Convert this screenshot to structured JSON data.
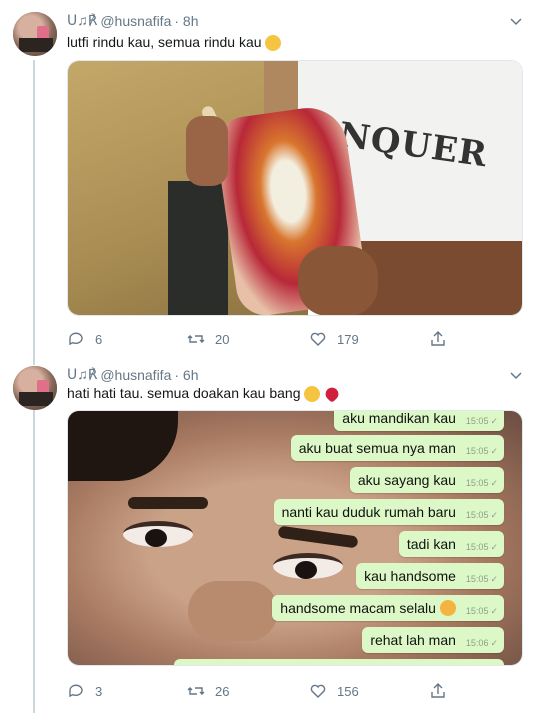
{
  "tweets": [
    {
      "handle": "@husnafifa",
      "name_glyphs": "ᑌ♫℟",
      "time": "· 8h",
      "text": "lutfi rindu kau, semua rindu kau",
      "replies": "6",
      "retweets": "20",
      "likes": "179"
    },
    {
      "handle": "@husnafifa",
      "name_glyphs": "ᑌ♫℟",
      "time": "· 6h",
      "text": "hati hati tau. semua doakan kau bang",
      "replies": "3",
      "retweets": "26",
      "likes": "156",
      "chat": [
        {
          "text": "aku mandikan kau",
          "time": "15:05"
        },
        {
          "text": "aku buat semua nya man",
          "time": "15:05"
        },
        {
          "text": "aku sayang kau",
          "time": "15:05"
        },
        {
          "text": "nanti kau duduk rumah baru",
          "time": "15:05"
        },
        {
          "text": "tadi kan",
          "time": "15:05"
        },
        {
          "text": "kau handsome",
          "time": "15:05"
        },
        {
          "text": "handsome macam selalu",
          "time": "15:05"
        },
        {
          "text": "rehat lah man",
          "time": "15:06"
        }
      ]
    }
  ],
  "colors": {
    "text": "#14171a",
    "secondary": "#657786",
    "bubble": "#dcf8c6",
    "thread": "#ccd6dd"
  },
  "icons": [
    "reply-icon",
    "retweet-icon",
    "like-icon",
    "share-icon",
    "chevron-down-icon"
  ]
}
